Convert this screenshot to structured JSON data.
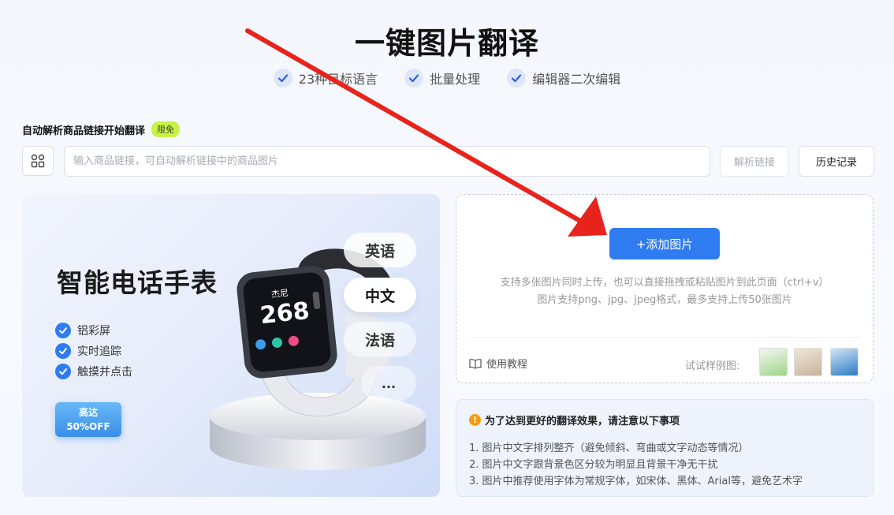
{
  "header": {
    "title": "一键图片翻译",
    "features": [
      "23种目标语言",
      "批量处理",
      "编辑器二次编辑"
    ]
  },
  "link_section": {
    "label": "自动解析商品链接开始翻译",
    "badge": "限免",
    "input_placeholder": "输入商品链接，可自动解析链接中的商品图片",
    "input_value": "",
    "parse_button": "解析链接",
    "history_button": "历史记录"
  },
  "banner": {
    "title": "智能电话手表",
    "features": [
      "铝彩屏",
      "实时追踪",
      "触摸并点击"
    ],
    "promo_line1": "高达",
    "promo_line2": "50%OFF",
    "watch_name": "杰尼",
    "watch_number": "268",
    "languages": [
      "英语",
      "中文",
      "法语",
      "..."
    ]
  },
  "upload": {
    "button": "+添加图片",
    "tip1": "支持多张图片同时上传，也可以直接拖拽或粘贴图片到此页面（ctrl+v）",
    "tip2": "图片支持png、jpg、jpeg格式，最多支持上传50张图片",
    "tutorial": "使用教程",
    "samples_label": "试试样例图:"
  },
  "notice": {
    "title": "为了达到更好的翻译效果，请注意以下事项",
    "items": [
      "1. 图片中文字排列整齐（避免倾斜、弯曲或文字动态等情况）",
      "2. 图片中文字跟背景色区分较为明显且背景干净无干扰",
      "3. 图片中推荐使用字体为常规字体，如宋体、黑体、Arial等，避免艺术字"
    ]
  },
  "colors": {
    "primary": "#2f7cf0",
    "badge": "#c8f24a",
    "arrow": "#e8231c",
    "warning": "#f39c12"
  }
}
